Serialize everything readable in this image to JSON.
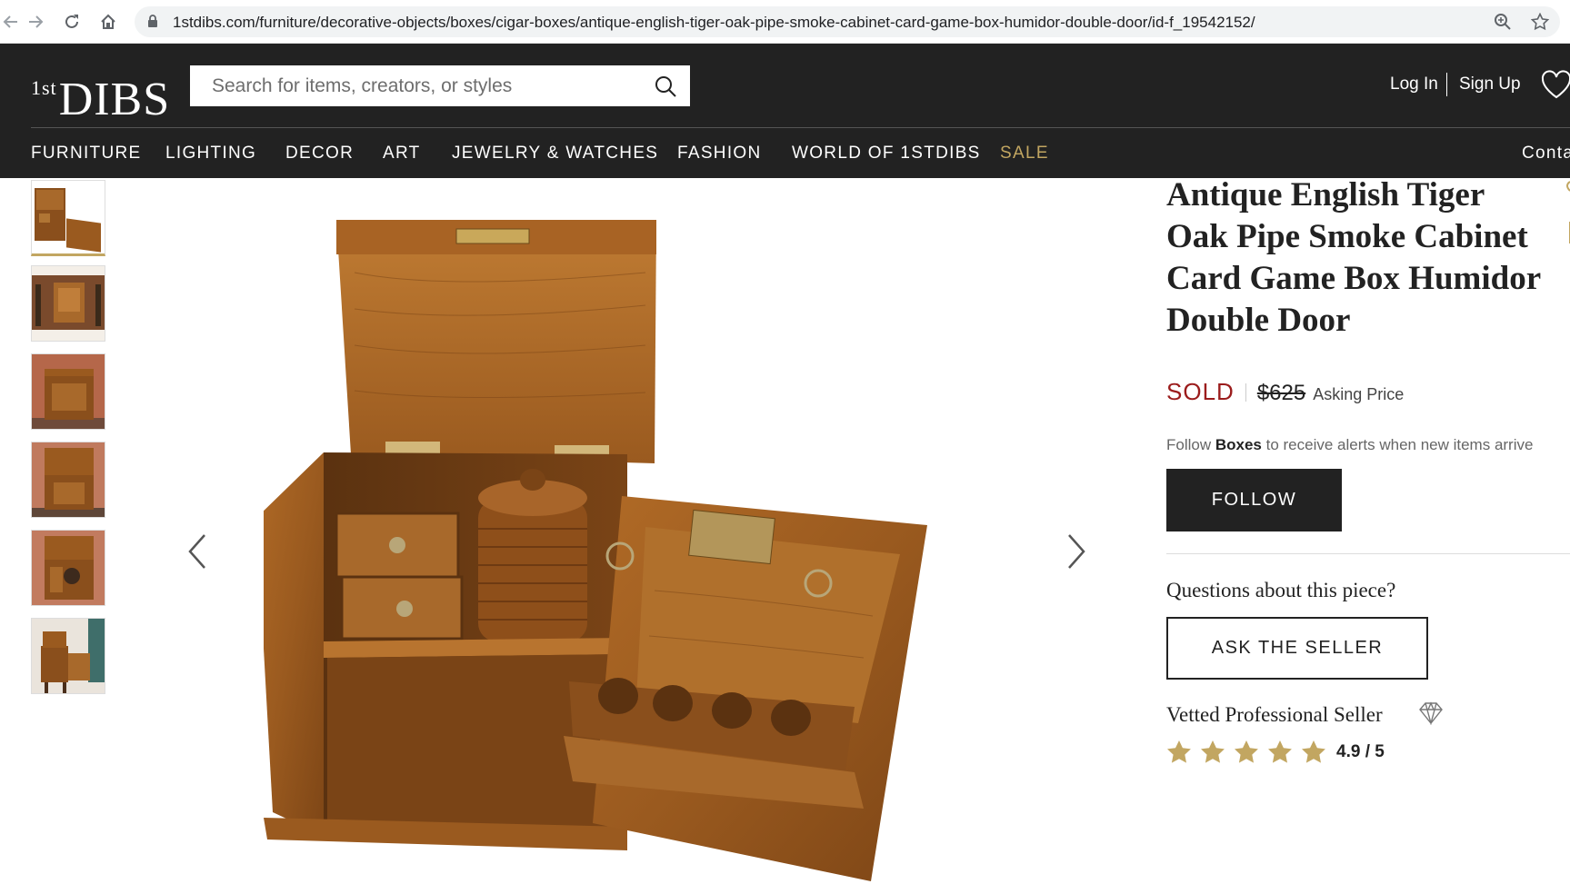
{
  "browser": {
    "url": "1stdibs.com/furniture/decorative-objects/boxes/cigar-boxes/antique-english-tiger-oak-pipe-smoke-cabinet-card-game-box-humidor-double-door/id-f_19542152/"
  },
  "header": {
    "logo_text": "DIBS",
    "logo_prefix": "1st",
    "search_placeholder": "Search for items, creators, or styles",
    "login_label": "Log In",
    "signup_label": "Sign Up"
  },
  "nav": {
    "items": [
      "FURNITURE",
      "LIGHTING",
      "DECOR",
      "ART",
      "JEWELRY & WATCHES",
      "FASHION",
      "WORLD OF 1STDIBS",
      "SALE"
    ],
    "contact_label": "Contac"
  },
  "product": {
    "title": "Antique English Tiger Oak Pipe Smoke Cabinet Card Game Box Humidor Double Door",
    "status": "SOLD",
    "price": "$625",
    "price_label": "Asking Price",
    "follow_prefix": "Follow ",
    "follow_category": "Boxes",
    "follow_suffix": " to receive alerts when new items arrive",
    "follow_button": "FOLLOW",
    "questions_heading": "Questions about this piece?",
    "ask_button": "ASK THE SELLER",
    "seller_badge": "Vetted Professional Seller",
    "rating_text": "4.9 / 5",
    "rating_value": 4.9,
    "rating_max": 5
  },
  "gallery": {
    "thumbnail_count": 6,
    "active_index": 0
  },
  "colors": {
    "header_bg": "#222222",
    "sale_accent": "#c2a661",
    "sold_red": "#9b1c1c",
    "star_gold": "#c2a661",
    "wood": "#9a5a1f"
  }
}
